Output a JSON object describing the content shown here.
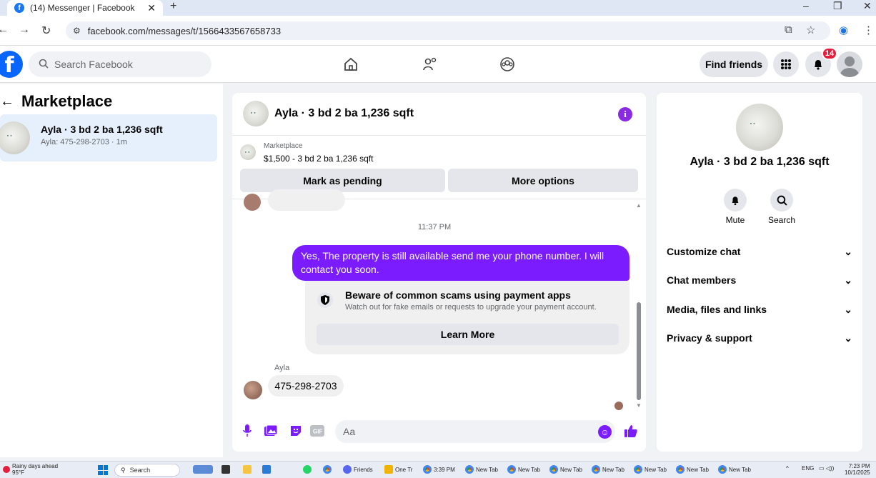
{
  "browser": {
    "tab_title": "(14) Messenger | Facebook",
    "url": "facebook.com/messages/t/1566433567658733"
  },
  "fb": {
    "search_placeholder": "Search Facebook",
    "find_friends": "Find friends",
    "notification_count": "14"
  },
  "left": {
    "title": "Marketplace",
    "conversation": {
      "name": "Ayla · 3 bd 2 ba 1,236 sqft",
      "preview": "Ayla: 475-298-2703 · 1m"
    }
  },
  "chat": {
    "title": "Ayla · 3 bd 2 ba 1,236 sqft",
    "marketplace_label": "Marketplace",
    "listing": "$1,500 - 3 bd 2 ba 1,236 sqft",
    "mark_pending": "Mark as pending",
    "more_options": "More options",
    "timestamp": "11:37 PM",
    "outgoing_message": "Yes, The property is still available send me your phone number. I will contact you soon.",
    "scam_title": "Beware of common scams using payment apps",
    "scam_text": "Watch out for fake emails or requests to upgrade your payment account.",
    "learn_more": "Learn More",
    "sender_name": "Ayla",
    "incoming_message": "475-298-2703",
    "input_placeholder": "Aa"
  },
  "right": {
    "name": "Ayla · 3 bd 2 ba 1,236 sqft",
    "mute": "Mute",
    "search": "Search",
    "sections": [
      "Customize chat",
      "Chat members",
      "Media, files and links",
      "Privacy & support"
    ]
  },
  "taskbar": {
    "weather_line1": "Rainy days ahead",
    "weather_line2": "95°F",
    "search": "Search",
    "apps": [
      "Friends",
      "One Tr",
      "3:39 PM",
      "New Tab",
      "New Tab",
      "New Tab",
      "New Tab",
      "New Tab",
      "New Tab",
      "New Tab"
    ],
    "lang": "ENG",
    "time": "7:23 PM",
    "date": "10/1/2025"
  }
}
